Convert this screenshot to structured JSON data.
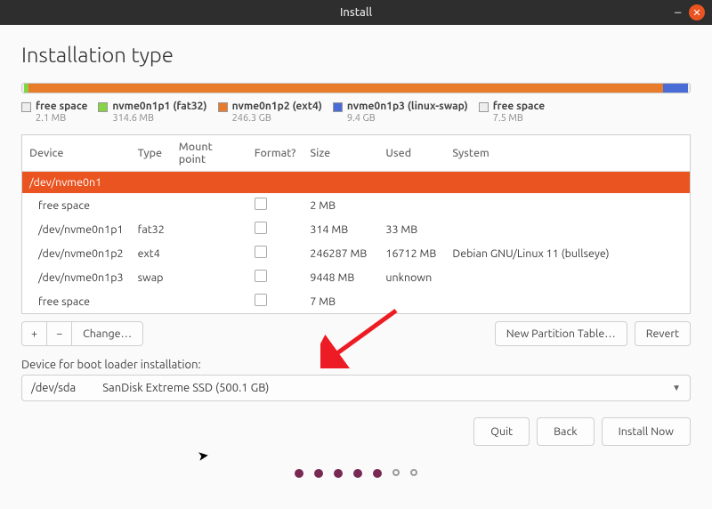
{
  "window": {
    "title": "Install"
  },
  "page": {
    "heading": "Installation type"
  },
  "legend": [
    {
      "name": "free space",
      "size": "2.1 MB",
      "color": "#eeeeee"
    },
    {
      "name": "nvme0n1p1 (fat32)",
      "size": "314.6 MB",
      "color": "#86d445"
    },
    {
      "name": "nvme0n1p2 (ext4)",
      "size": "246.3 GB",
      "color": "#e87c2b"
    },
    {
      "name": "nvme0n1p3 (linux-swap)",
      "size": "9.4 GB",
      "color": "#4a6cd6"
    },
    {
      "name": "free space",
      "size": "7.5 MB",
      "color": "#eeeeee"
    }
  ],
  "table": {
    "headers": {
      "device": "Device",
      "type": "Type",
      "mount": "Mount point",
      "format": "Format?",
      "size": "Size",
      "used": "Used",
      "system": "System"
    },
    "rows": [
      {
        "device": "/dev/nvme0n1",
        "selected": true
      },
      {
        "device": "free space",
        "type": "",
        "size": "2 MB",
        "used": "",
        "system": "",
        "child": true,
        "fmt": true
      },
      {
        "device": "/dev/nvme0n1p1",
        "type": "fat32",
        "size": "314 MB",
        "used": "33 MB",
        "system": "",
        "child": true,
        "fmt": true
      },
      {
        "device": "/dev/nvme0n1p2",
        "type": "ext4",
        "size": "246287 MB",
        "used": "16712 MB",
        "system": "Debian GNU/Linux 11 (bullseye)",
        "child": true,
        "fmt": true
      },
      {
        "device": "/dev/nvme0n1p3",
        "type": "swap",
        "size": "9448 MB",
        "used": "unknown",
        "system": "",
        "child": true,
        "fmt": true
      },
      {
        "device": "free space",
        "type": "",
        "size": "7 MB",
        "used": "",
        "system": "",
        "child": true,
        "fmt": true
      }
    ]
  },
  "toolbar": {
    "add": "+",
    "remove": "−",
    "change": "Change…",
    "new_table": "New Partition Table…",
    "revert": "Revert"
  },
  "boot": {
    "label": "Device for boot loader installation:",
    "device": "/dev/sda",
    "desc": "SanDisk Extreme SSD (500.1 GB)"
  },
  "nav": {
    "quit": "Quit",
    "back": "Back",
    "install": "Install Now"
  }
}
